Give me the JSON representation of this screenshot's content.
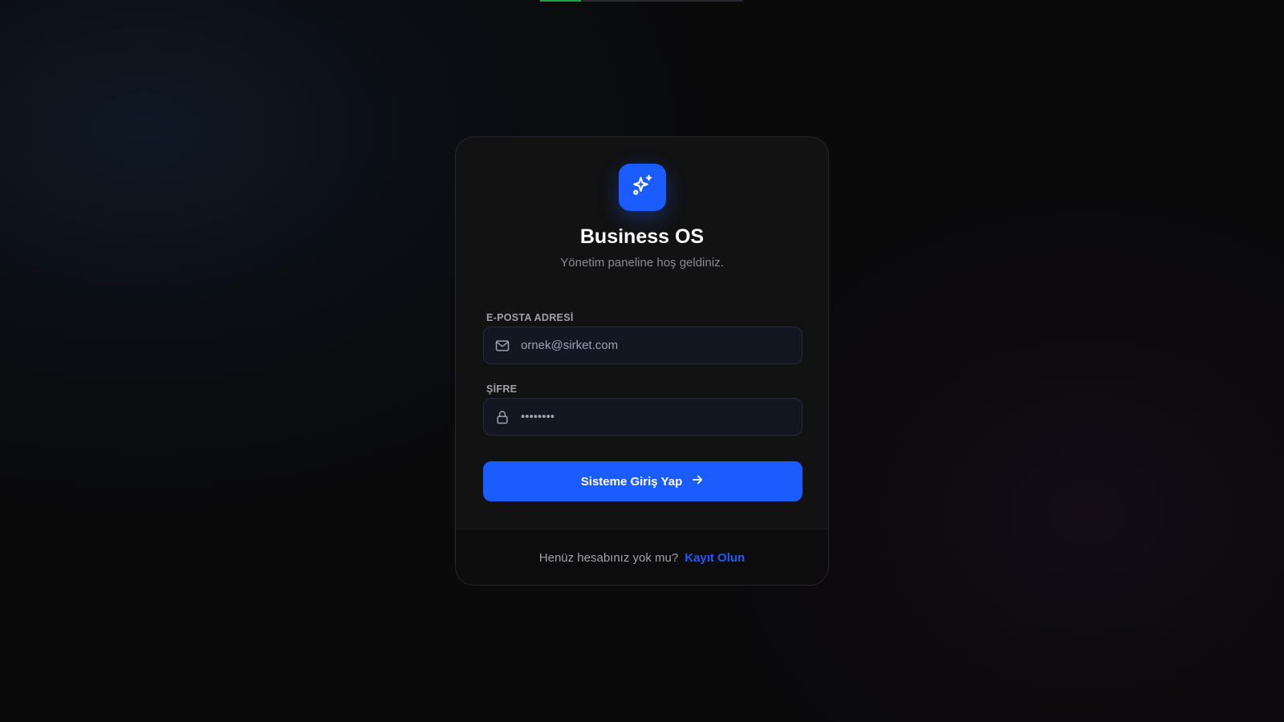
{
  "top_progress": {
    "fraction": 0.2,
    "color": "#16a34a"
  },
  "brand": {
    "logo_icon": "sparkles-icon",
    "title": "Business OS",
    "subtitle": "Yönetim paneline hoş geldiniz."
  },
  "form": {
    "email": {
      "label": "E-POSTA ADRESİ",
      "placeholder": "ornek@sirket.com",
      "value": "",
      "icon": "mail-icon"
    },
    "password": {
      "label": "ŞİFRE",
      "placeholder": "••••••••",
      "value": "",
      "icon": "lock-icon"
    },
    "submit_label": "Sisteme Giriş Yap",
    "submit_icon": "arrow-right-icon"
  },
  "footer": {
    "text": "Henüz hesabınız yok mu?",
    "link_label": "Kayıt Olun"
  },
  "colors": {
    "accent": "#1a5cff",
    "background": "#0a0a0b",
    "card": "#121213",
    "input_bg": "#121722"
  }
}
